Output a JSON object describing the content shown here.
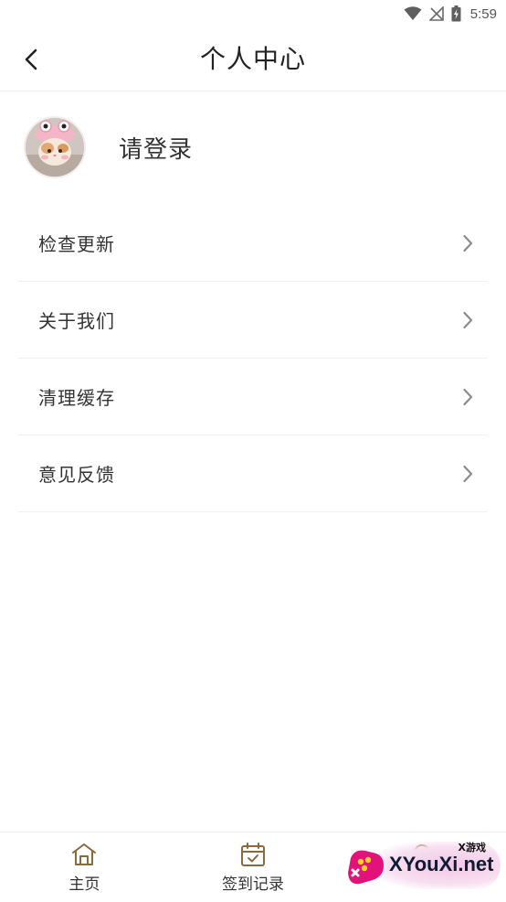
{
  "status_bar": {
    "time": "5:59",
    "icons": [
      "wifi-icon",
      "signal-icon",
      "battery-icon"
    ]
  },
  "header": {
    "title": "个人中心",
    "back_icon": "chevron-left-icon"
  },
  "profile": {
    "login_text": "请登录",
    "avatar": "cat-avatar"
  },
  "menu": {
    "items": [
      {
        "label": "检查更新",
        "icon": "chevron-right-icon"
      },
      {
        "label": "关于我们",
        "icon": "chevron-right-icon"
      },
      {
        "label": "清理缓存",
        "icon": "chevron-right-icon"
      },
      {
        "label": "意见反馈",
        "icon": "chevron-right-icon"
      }
    ]
  },
  "bottom_nav": {
    "items": [
      {
        "label": "主页",
        "icon": "home-icon"
      },
      {
        "label": "签到记录",
        "icon": "calendar-check-icon"
      },
      {
        "label": "",
        "icon": "location-icon"
      }
    ]
  },
  "watermark": {
    "small": "X游戏",
    "text": "XYouXi.net"
  },
  "colors": {
    "accent": "#8a6a3b",
    "text": "#333333",
    "divider": "#f0f0f0"
  }
}
